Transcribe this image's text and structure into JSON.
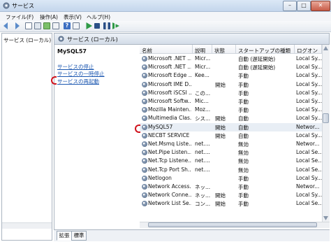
{
  "window": {
    "title": "サービス",
    "controls": {
      "minimize": "–",
      "maximize": "□",
      "close": "✕"
    }
  },
  "menu": [
    "ファイル(F)",
    "操作(A)",
    "表示(V)",
    "ヘルプ(H)"
  ],
  "tree": {
    "item": "サービス (ローカル)"
  },
  "panel": {
    "title": "サービス (ローカル)"
  },
  "detail": {
    "service_name": "MySQL57",
    "links": [
      "サービスの停止",
      "サービスの一時停止",
      "サービスの再起動"
    ]
  },
  "list": {
    "columns": [
      "名前",
      "説明",
      "状態",
      "スタートアップの種類",
      "ログオン"
    ],
    "rows": [
      {
        "name": "Microsoft .NET ...",
        "desc": "Micr...",
        "status": "",
        "startup": "自動 (遅延開始)",
        "logon": "Local Sy..."
      },
      {
        "name": "Microsoft .NET ...",
        "desc": "Micr...",
        "status": "",
        "startup": "自動 (遅延開始)",
        "logon": "Local Sy..."
      },
      {
        "name": "Microsoft Edge ...",
        "desc": "Kee...",
        "status": "",
        "startup": "手動",
        "logon": "Local Sy..."
      },
      {
        "name": "Microsoft IME D...",
        "desc": "",
        "status": "開始",
        "startup": "手動",
        "logon": "Local Sy..."
      },
      {
        "name": "Microsoft iSCSI ...",
        "desc": "この...",
        "status": "",
        "startup": "手動",
        "logon": "Local Sy..."
      },
      {
        "name": "Microsoft Softw...",
        "desc": "Mic...",
        "status": "",
        "startup": "手動",
        "logon": "Local Sy..."
      },
      {
        "name": "Mozilla Mainten...",
        "desc": "Moz...",
        "status": "",
        "startup": "手動",
        "logon": "Local Sy..."
      },
      {
        "name": "Multimedia Clas...",
        "desc": "シス...",
        "status": "開始",
        "startup": "自動",
        "logon": "Local Sy..."
      },
      {
        "name": "MySQL57",
        "desc": "",
        "status": "開始",
        "startup": "自動",
        "logon": "Networ..."
      },
      {
        "name": "NECBT SERVICE",
        "desc": "",
        "status": "開始",
        "startup": "自動",
        "logon": "Local Sy..."
      },
      {
        "name": "Net.Msmq Liste...",
        "desc": "net....",
        "status": "",
        "startup": "無効",
        "logon": "Networ..."
      },
      {
        "name": "Net.Pipe Listen...",
        "desc": "net....",
        "status": "",
        "startup": "無効",
        "logon": "Local Se..."
      },
      {
        "name": "Net.Tcp Listene...",
        "desc": "net....",
        "status": "",
        "startup": "無効",
        "logon": "Local Se..."
      },
      {
        "name": "Net.Tcp Port Sh...",
        "desc": "net....",
        "status": "",
        "startup": "無効",
        "logon": "Local Se..."
      },
      {
        "name": "Netlogon",
        "desc": "",
        "status": "",
        "startup": "手動",
        "logon": "Local Sy..."
      },
      {
        "name": "Network Access...",
        "desc": "ネッ...",
        "status": "",
        "startup": "手動",
        "logon": "Networ..."
      },
      {
        "name": "Network Conne...",
        "desc": "ネッ...",
        "status": "開始",
        "startup": "手動",
        "logon": "Local Sy..."
      },
      {
        "name": "Network List Se...",
        "desc": "コン...",
        "status": "開始",
        "startup": "手動",
        "logon": "Local Se..."
      }
    ]
  },
  "tabs": [
    "拡張",
    "標準"
  ],
  "colors": {
    "accent": "#d0121c",
    "link": "#1a56b0",
    "selected_row": "#e8eef5"
  }
}
